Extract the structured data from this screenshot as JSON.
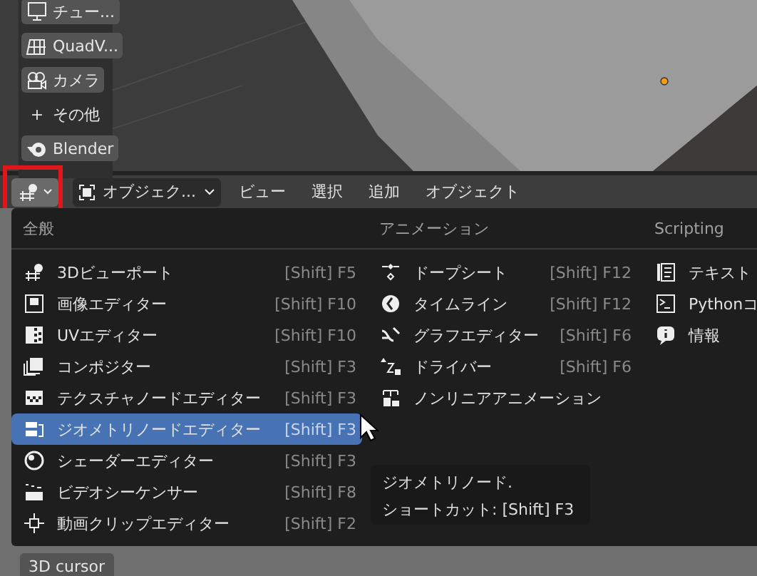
{
  "toolbar": [
    {
      "label": "チュー..."
    },
    {
      "label": "QuadV..."
    },
    {
      "label": "カメラ"
    },
    {
      "label": "その他",
      "plus": "+"
    },
    {
      "label": "Blender"
    }
  ],
  "header": {
    "mode": "オブジェク...",
    "menus": [
      "ビュー",
      "選択",
      "追加",
      "オブジェクト"
    ]
  },
  "editor_menu": {
    "columns": [
      {
        "title": "全般",
        "items": [
          {
            "label": "3Dビューポート",
            "shortcut": "[Shift] F5",
            "selected": false
          },
          {
            "label": "画像エディター",
            "shortcut": "[Shift] F10",
            "selected": false
          },
          {
            "label": "UVエディター",
            "shortcut": "[Shift] F10",
            "selected": false
          },
          {
            "label": "コンポジター",
            "shortcut": "[Shift] F3",
            "selected": false
          },
          {
            "label": "テクスチャノードエディター",
            "shortcut": "[Shift] F3",
            "selected": false
          },
          {
            "label": "ジオメトリノードエディター",
            "shortcut": "[Shift] F3",
            "selected": true
          },
          {
            "label": "シェーダーエディター",
            "shortcut": "[Shift] F3",
            "selected": false
          },
          {
            "label": "ビデオシーケンサー",
            "shortcut": "[Shift] F8",
            "selected": false
          },
          {
            "label": "動画クリップエディター",
            "shortcut": "[Shift] F2",
            "selected": false
          }
        ]
      },
      {
        "title": "アニメーション",
        "items": [
          {
            "label": "ドープシート",
            "shortcut": "[Shift] F12",
            "selected": false
          },
          {
            "label": "タイムライン",
            "shortcut": "[Shift] F12",
            "selected": false
          },
          {
            "label": "グラフエディター",
            "shortcut": "[Shift] F6",
            "selected": false
          },
          {
            "label": "ドライバー",
            "shortcut": "[Shift] F6",
            "selected": false
          },
          {
            "label": "ノンリニアアニメーション",
            "selected": false
          }
        ]
      },
      {
        "title": "Scripting",
        "items": [
          {
            "label": "テキスト",
            "selected": false
          },
          {
            "label": "Pythonコ",
            "selected": false
          },
          {
            "label": "情報",
            "selected": false
          }
        ]
      }
    ]
  },
  "tooltip": {
    "title": "ジオメトリノード.",
    "shortcut": "ショートカット: [Shift] F3"
  },
  "bottom_button": "3D cursor"
}
